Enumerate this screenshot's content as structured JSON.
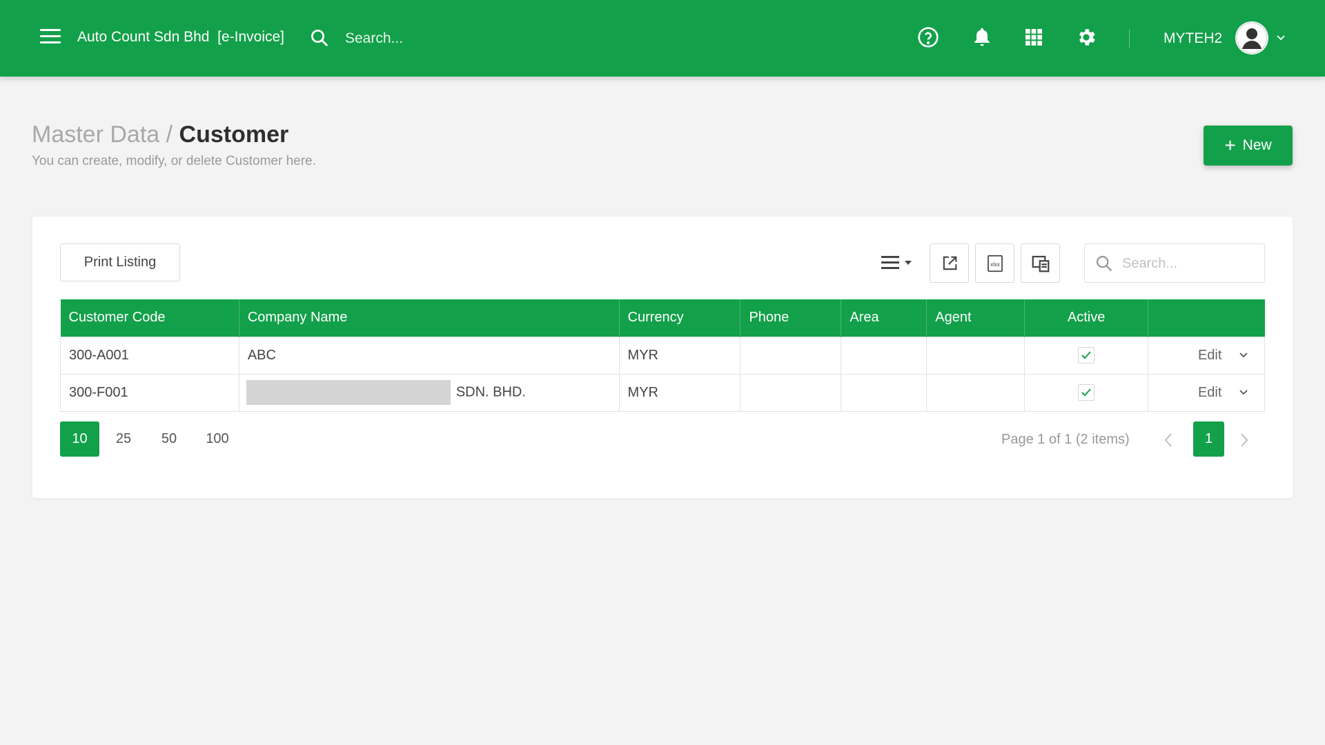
{
  "header": {
    "company": "Auto Count Sdn Bhd  [e-Invoice]",
    "search_placeholder": "Search...",
    "username": "MYTEH2"
  },
  "page": {
    "breadcrumb_parent": "Master Data",
    "breadcrumb_separator": "/",
    "title": "Customer",
    "subtitle": "You can create, modify, or delete Customer here.",
    "new_button": "New"
  },
  "toolbar": {
    "print_label": "Print Listing",
    "search_placeholder": "Search..."
  },
  "table": {
    "columns": [
      "Customer Code",
      "Company Name",
      "Currency",
      "Phone",
      "Area",
      "Agent",
      "Active",
      ""
    ],
    "rows": [
      {
        "code": "300-A001",
        "company": "ABC",
        "currency": "MYR",
        "phone": "",
        "area": "",
        "agent": "",
        "active": true,
        "action": "Edit"
      },
      {
        "code": "300-F001",
        "company": "SDN. BHD.",
        "currency": "MYR",
        "phone": "",
        "area": "",
        "agent": "",
        "active": true,
        "action": "Edit"
      }
    ]
  },
  "pagination": {
    "sizes": [
      "10",
      "25",
      "50",
      "100"
    ],
    "selected_size": "10",
    "info": "Page 1 of 1 (2 items)",
    "current_page": "1"
  },
  "colors": {
    "brand": "#13a04a",
    "background": "#f3f3f3"
  }
}
